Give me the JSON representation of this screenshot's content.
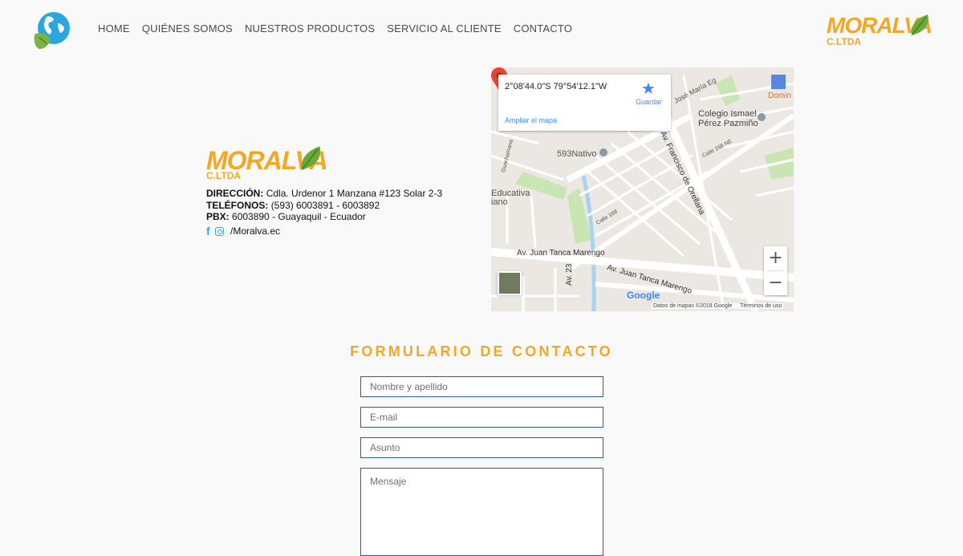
{
  "header": {
    "nav": [
      "HOME",
      "QUIÉNES SOMOS",
      "NUESTROS PRODUCTOS",
      "SERVICIO AL CLIENTE",
      "CONTACTO"
    ],
    "logo_icon": "globe-leaf-icon",
    "brand_name": "MORALVA",
    "brand_sub": "C.LTDA"
  },
  "company": {
    "brand_name": "MORALVA",
    "brand_sub": "C.LTDA",
    "address_label": "DIRECCIÓN:",
    "address": "Cdla. Urdenor 1 Manzana #123 Solar 2-3",
    "phones_label": "TELÉFONOS:",
    "phones": "(593) 6003891 - 6003892",
    "pbx_label": "PBX:",
    "pbx": "6003890 - Guayaquil - Ecuador",
    "social_handle": "/Moralva.ec",
    "social_icons": [
      "facebook-icon",
      "instagram-icon"
    ]
  },
  "map": {
    "coordinates": "2°08'44.0\"S 79°54'12.1\"W",
    "save_label": "Guardar",
    "larger_map": "Ampliar el mapa",
    "attribution": "Datos de mapas ©2018 Google",
    "terms": "Términos de uso",
    "google": "Google",
    "labels": {
      "school": "Colegio Ismael",
      "school2": "Pérez Pazmiño",
      "place": "593Nativo",
      "educativa": "Educativa",
      "educativa2": "iano",
      "street1": "Av. Juan Tanca Marengo",
      "street2": "Av. Juan Tanca Marengo",
      "street3": "Av. Francisco de Orellana",
      "av23": "Av. 23",
      "domino": "Domin",
      "jose": "José María Eg",
      "calle168ne": "Calle 168 NE",
      "guachamama": "Guachamana",
      "calle168": "Calle 168"
    }
  },
  "form": {
    "title": "FORMULARIO DE CONTACTO",
    "name_placeholder": "Nombre y apellido",
    "email_placeholder": "E-mail",
    "subject_placeholder": "Asunto",
    "message_placeholder": "Mensaje"
  },
  "colors": {
    "accent": "#f5a623",
    "link": "#4285f4",
    "field_border": "#2f5b9a"
  }
}
